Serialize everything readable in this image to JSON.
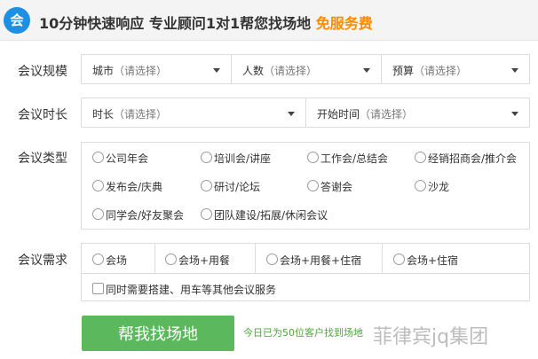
{
  "header": {
    "logo_char": "会",
    "title": "10分钟快速响应 专业顾问1对1帮您找场地 ",
    "free": "免服务费"
  },
  "rows": {
    "scale": {
      "label": "会议规模",
      "selects": [
        {
          "name": "城市",
          "placeholder": "（请选择）"
        },
        {
          "name": "人数",
          "placeholder": "（请选择）"
        },
        {
          "name": "预算",
          "placeholder": "（请选择）"
        }
      ]
    },
    "duration": {
      "label": "会议时长",
      "selects": [
        {
          "name": "时长",
          "placeholder": "（请选择）"
        },
        {
          "name": "开始时间",
          "placeholder": "（请选择）"
        }
      ]
    },
    "type": {
      "label": "会议类型",
      "options": [
        "公司年会",
        "培训会/讲座",
        "工作会/总结会",
        "经销招商会/推介会",
        "发布会/庆典",
        "研讨/论坛",
        "答谢会",
        "沙龙",
        "同学会/好友聚会",
        "团队建设/拓展/休闲会议"
      ]
    },
    "needs": {
      "label": "会议需求",
      "options": [
        "会场",
        "会场+用餐",
        "会场+用餐+住宿",
        "会场+住宿"
      ],
      "extra": "同时需要搭建、用车等其他会议服务"
    }
  },
  "submit": {
    "label": "帮我找场地",
    "stat": "今日已为50位客户找到场地"
  },
  "watermark": "菲律宾jq集团",
  "colors": {
    "accent_blue": "#1e8fe1",
    "free_orange": "#ff8a00",
    "button_green": "#5cb85c",
    "stat_green": "#4ca63a"
  }
}
